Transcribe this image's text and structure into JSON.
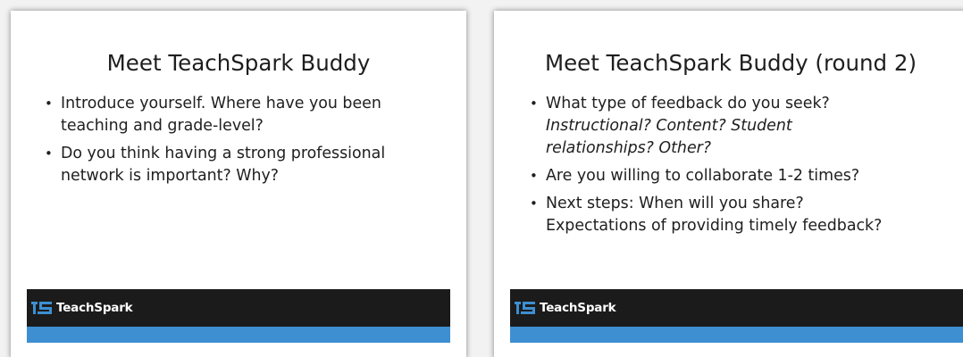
{
  "colors": {
    "footer_dark": "#1b1b1b",
    "footer_blue": "#3d8fd1",
    "logo_blue": "#3d8fd1"
  },
  "slides": [
    {
      "title": "Meet TeachSpark Buddy",
      "bullets": [
        {
          "lines": [
            "Introduce yourself.  Where have you been",
            "teaching and grade-level?"
          ]
        },
        {
          "lines": [
            "Do you think having a strong professional",
            "network is important?  Why?"
          ]
        }
      ],
      "footer": {
        "brand": "TeachSpark",
        "logo_icon": "teachspark-logo-icon"
      }
    },
    {
      "title": "Meet TeachSpark Buddy (round 2)",
      "bullets": [
        {
          "lines": [
            "What type of feedback do you seek?",
            "Instructional?  Content?  Student",
            "relationships?  Other?"
          ]
        },
        {
          "lines": [
            "Are you willing to collaborate 1-2 times?"
          ]
        },
        {
          "lines": [
            "Next steps: When will you share?",
            "Expectations of providing timely feedback?"
          ]
        }
      ],
      "footer": {
        "brand": "TeachSpark",
        "logo_icon": "teachspark-logo-icon"
      }
    }
  ]
}
